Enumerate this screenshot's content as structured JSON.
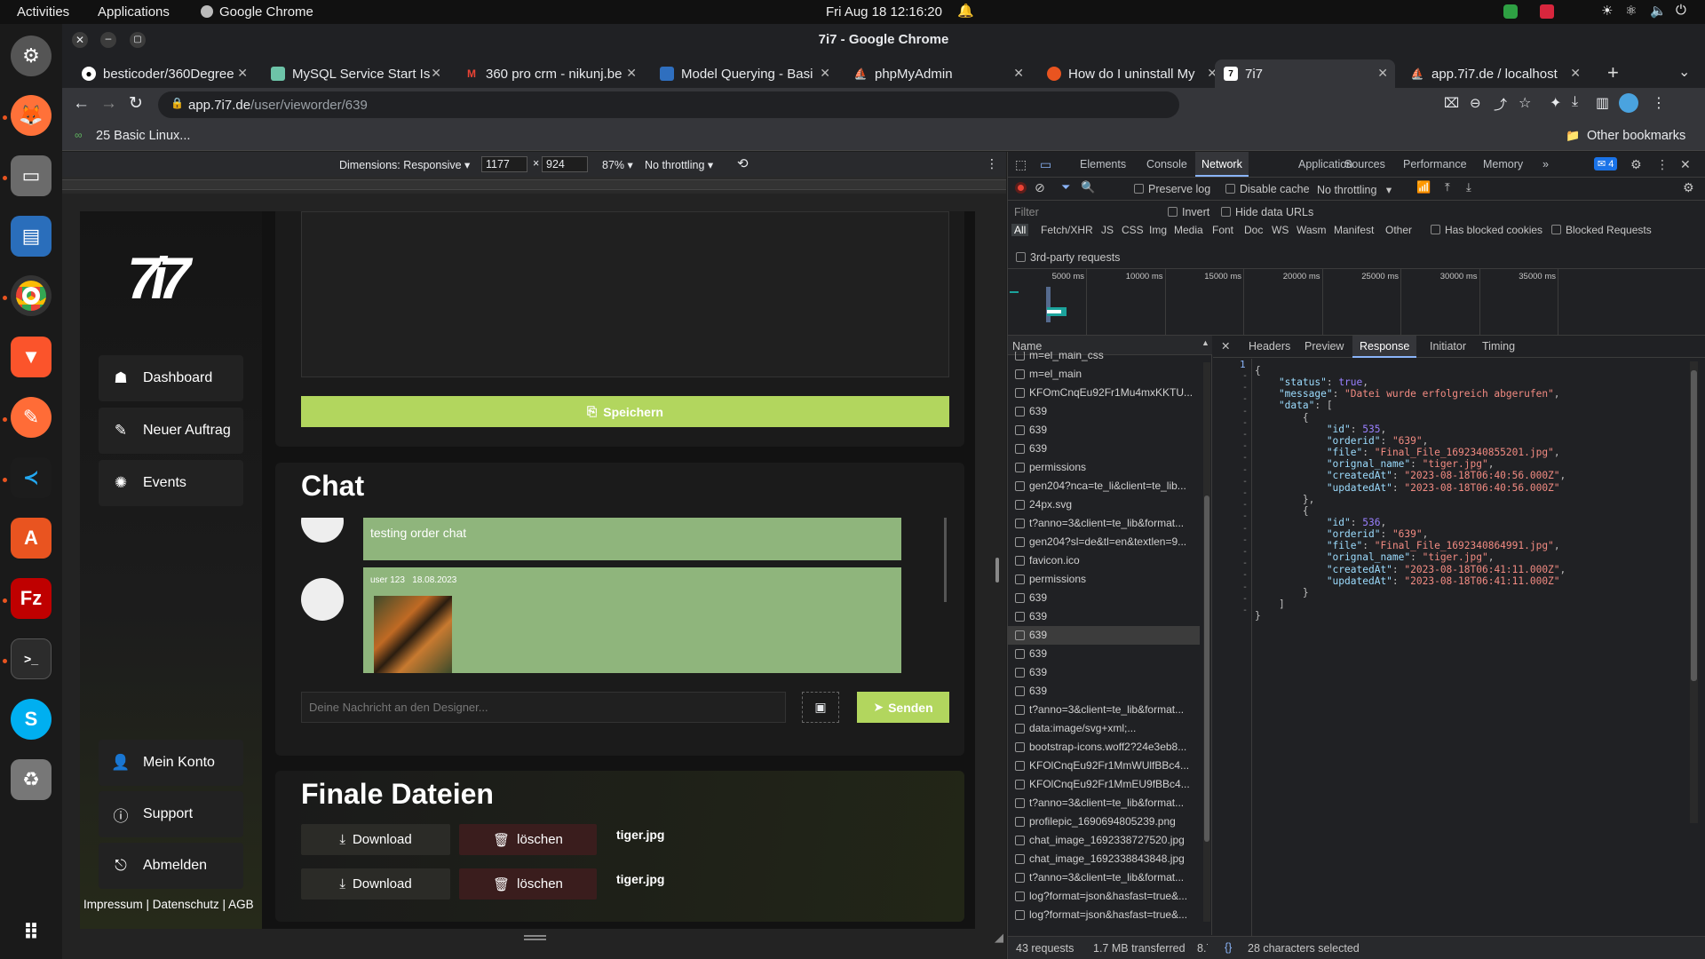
{
  "topbar": {
    "activities": "Activities",
    "applications": "Applications",
    "app": "Google Chrome",
    "clock": "Fri Aug 18  12:16:20"
  },
  "dock": [
    {
      "name": "settings-icon"
    },
    {
      "name": "firefox-icon"
    },
    {
      "name": "files-icon"
    },
    {
      "name": "writer-icon"
    },
    {
      "name": "chrome-icon"
    },
    {
      "name": "brave-icon"
    },
    {
      "name": "postman-icon"
    },
    {
      "name": "vscode-icon"
    },
    {
      "name": "app-center-icon"
    },
    {
      "name": "filezilla-icon"
    },
    {
      "name": "terminal-icon"
    },
    {
      "name": "skype-icon"
    },
    {
      "name": "trash-icon"
    },
    {
      "name": "app-grid-icon"
    }
  ],
  "window": {
    "title": "7i7 - Google Chrome"
  },
  "tabs": [
    {
      "label": "besticoder/360Degree",
      "color": "#ffffff"
    },
    {
      "label": "MySQL Service Start Is",
      "color": "#6dc3a8"
    },
    {
      "label": "360 pro crm - nikunj.be",
      "color": "#ea4335"
    },
    {
      "label": "Model Querying - Basi",
      "color": "#2f6fbf"
    },
    {
      "label": "phpMyAdmin",
      "color": "#f29111"
    },
    {
      "label": "How do I uninstall My",
      "color": "#e95420"
    },
    {
      "label": "7i7",
      "color": "#ffffff"
    },
    {
      "label": "app.7i7.de / localhost",
      "color": "#f29111"
    }
  ],
  "url": {
    "domain": "app.7i7.de",
    "path": "/user/vieworder/639"
  },
  "bookmarks": {
    "item": "25 Basic Linux...",
    "other": "Other bookmarks"
  },
  "devbar": {
    "dimensions": "Dimensions: Responsive",
    "width": "1177",
    "height": "924",
    "zoom": "87%",
    "throttle": "No throttling"
  },
  "site": {
    "logo": "7i7",
    "nav": {
      "dashboard": "Dashboard",
      "new_order": "Neuer Auftrag",
      "events": "Events",
      "account": "Mein Konto",
      "support": "Support",
      "logout": "Abmelden"
    },
    "footer": "Impressum | Datenschutz | AGB",
    "save_label": "Speichern",
    "chat": {
      "title": "Chat",
      "msg1": "testing order chat",
      "meta_user": "user 123",
      "meta_date": "18.08.2023",
      "placeholder": "Deine Nachricht an den Designer...",
      "send": "Senden"
    },
    "files": {
      "title": "Finale Dateien",
      "download": "Download",
      "delete": "löschen",
      "rows": [
        {
          "name": "tiger.jpg"
        },
        {
          "name": "tiger.jpg"
        }
      ]
    }
  },
  "devtools": {
    "tabs": [
      "Elements",
      "Console",
      "Network",
      "Application",
      "Sources",
      "Performance",
      "Memory"
    ],
    "issues": "4",
    "toolbar": {
      "preserve": "Preserve log",
      "disable_cache": "Disable cache",
      "throttle": "No throttling"
    },
    "filter": {
      "placeholder": "Filter",
      "invert": "Invert",
      "hide_data": "Hide data URLs",
      "third_party": "3rd-party requests",
      "blocked_cookies": "Has blocked cookies",
      "blocked_requests": "Blocked Requests"
    },
    "types": [
      "All",
      "Fetch/XHR",
      "JS",
      "CSS",
      "Img",
      "Media",
      "Font",
      "Doc",
      "WS",
      "Wasm",
      "Manifest",
      "Other"
    ],
    "timeline": [
      "5000 ms",
      "10000 ms",
      "15000 ms",
      "20000 ms",
      "25000 ms",
      "30000 ms",
      "35000 ms"
    ],
    "name_header": "Name",
    "requests": [
      "m=el_main_css",
      "m=el_main",
      "KFOmCnqEu92Fr1Mu4mxKKTU...",
      "639",
      "639",
      "639",
      "permissions",
      "gen204?nca=te_li&client=te_lib...",
      "24px.svg",
      "t?anno=3&client=te_lib&format...",
      "gen204?sl=de&tl=en&textlen=9...",
      "favicon.ico",
      "permissions",
      "639",
      "639",
      "639",
      "639",
      "639",
      "639",
      "t?anno=3&client=te_lib&format...",
      "data:image/svg+xml;...",
      "bootstrap-icons.woff2?24e3eb8...",
      "KFOlCnqEu92Fr1MmWUlfBBc4...",
      "KFOlCnqEu92Fr1MmEU9fBBc4...",
      "t?anno=3&client=te_lib&format...",
      "profilepic_1690694805239.png",
      "chat_image_1692338727520.jpg",
      "chat_image_1692338843848.jpg",
      "t?anno=3&client=te_lib&format...",
      "log?format=json&hasfast=true&...",
      "log?format=json&hasfast=true&..."
    ],
    "detail_tabs": [
      "Headers",
      "Preview",
      "Response",
      "Initiator",
      "Timing"
    ],
    "response": {
      "status": "true",
      "message": "\"Datei wurde erfolgreich abgerufen\"",
      "items": [
        {
          "id": "535",
          "orderid": "\"639\"",
          "file": "\"Final_File_1692340855201.jpg\"",
          "orignal_name": "\"tiger.jpg\"",
          "createdAt": "\"2023-08-18T06:40:56.000Z\"",
          "updatedAt": "\"2023-08-18T06:40:56.000Z\""
        },
        {
          "id": "536",
          "orderid": "\"639\"",
          "file": "\"Final_File_1692340864991.jpg\"",
          "orignal_name": "\"tiger.jpg\"",
          "createdAt": "\"2023-08-18T06:41:11.000Z\"",
          "updatedAt": "\"2023-08-18T06:41:11.000Z\""
        }
      ]
    },
    "status": {
      "requests": "43 requests",
      "transferred": "1.7 MB transferred",
      "extra": "8.7",
      "selection": "28 characters selected"
    }
  }
}
